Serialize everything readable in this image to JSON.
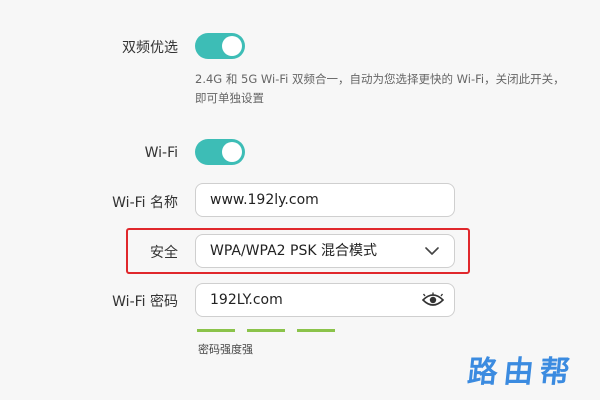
{
  "dual_band": {
    "label": "双频优选",
    "enabled": true,
    "description": "2.4G 和 5G Wi-Fi 双频合一，自动为您选择更快的 Wi-Fi，关闭此开关，即可单独设置"
  },
  "wifi": {
    "label": "Wi-Fi",
    "enabled": true
  },
  "wifi_name": {
    "label": "Wi-Fi 名称",
    "value": "www.192ly.com"
  },
  "security": {
    "label": "安全",
    "value": "WPA/WPA2 PSK 混合模式",
    "icon": "chevron-down-icon"
  },
  "wifi_password": {
    "label": "Wi-Fi 密码",
    "value": "192LY.com",
    "icon": "eye-icon"
  },
  "password_strength": {
    "text": "密码强度强",
    "level": 3,
    "max": 3,
    "color": "#8bc34a"
  },
  "watermark": "路由帮",
  "colors": {
    "toggle_on": "#3dbdb6",
    "highlight": "#e0282c"
  }
}
